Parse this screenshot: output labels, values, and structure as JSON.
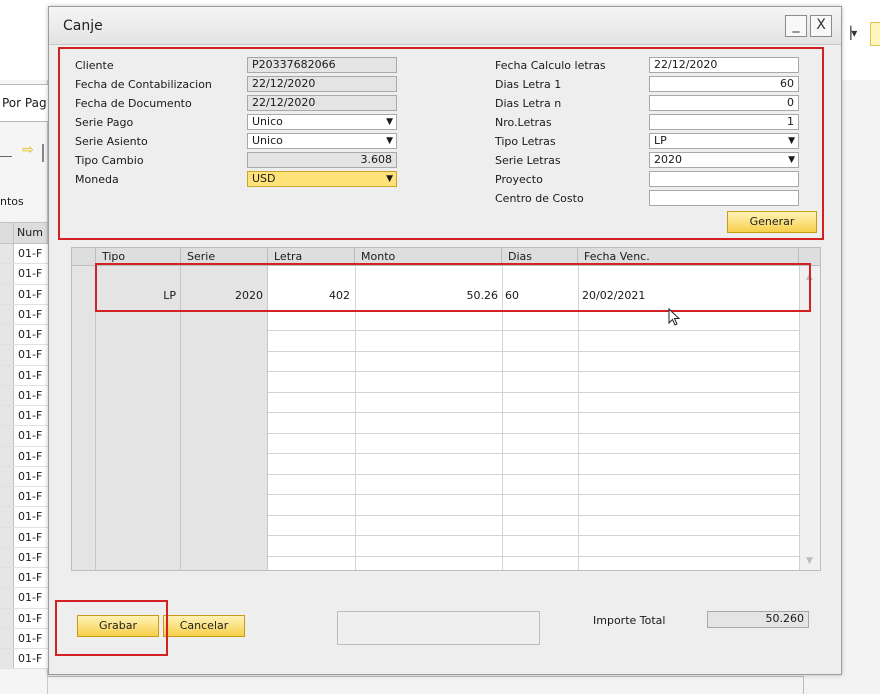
{
  "background": {
    "tab_label": "Por Pag",
    "section_label": "ntos",
    "table_header": "Num",
    "row_values": [
      "01-F",
      "01-F",
      "01-F",
      "01-F",
      "01-F",
      "01-F",
      "01-F",
      "01-F",
      "01-F",
      "01-F",
      "01-F",
      "01-F",
      "01-F",
      "01-F",
      "01-F",
      "01-F",
      "01-F",
      "01-F",
      "01-F",
      "01-F",
      "01-F"
    ]
  },
  "dialog": {
    "title": "Canje",
    "minimize": "_",
    "close": "X"
  },
  "left_fields": [
    {
      "label": "Cliente",
      "value": "P20337682066"
    },
    {
      "label": "Fecha de Contabilizacion",
      "value": "22/12/2020"
    },
    {
      "label": "Fecha de Documento",
      "value": "22/12/2020"
    },
    {
      "label": "Serie Pago",
      "value": "Unico"
    },
    {
      "label": "Serie Asiento",
      "value": "Unico"
    },
    {
      "label": "Tipo Cambio",
      "value": "3.608"
    },
    {
      "label": "Moneda",
      "value": "USD"
    }
  ],
  "right_fields": [
    {
      "label": "Fecha Calculo letras",
      "value": "22/12/2020"
    },
    {
      "label": "Dias Letra 1",
      "value": "60"
    },
    {
      "label": "Dias Letra n",
      "value": "0"
    },
    {
      "label": "Nro.Letras",
      "value": "1"
    },
    {
      "label": "Tipo Letras",
      "value": "LP"
    },
    {
      "label": "Serie Letras",
      "value": "2020"
    },
    {
      "label": "Proyecto",
      "value": ""
    },
    {
      "label": "Centro de Costo",
      "value": ""
    }
  ],
  "buttons": {
    "generar": "Generar",
    "grabar": "Grabar",
    "cancelar": "Cancelar"
  },
  "grid": {
    "columns": [
      "Tipo",
      "Serie",
      "Letra",
      "Monto",
      "Dias",
      "Fecha Venc."
    ],
    "rows": [
      {
        "tipo": "LP",
        "serie": "2020",
        "letra": "402",
        "monto": "50.26",
        "dias": "60",
        "fecha_venc": "20/02/2021"
      }
    ]
  },
  "footer": {
    "importe_total_label": "Importe Total",
    "importe_total_value": "50.260"
  },
  "colors": {
    "accent_yellow": "#f6cf4a",
    "annotation_red": "#d42020",
    "highlight_field": "#ffe27a"
  }
}
